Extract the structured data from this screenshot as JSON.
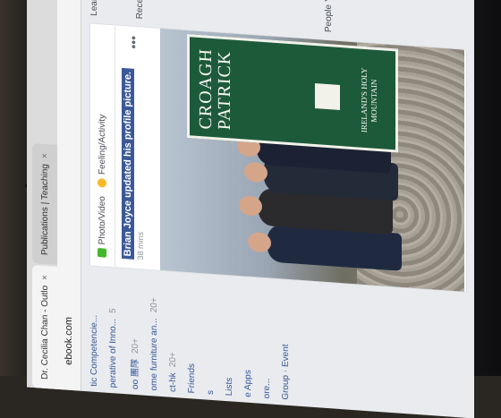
{
  "tabs": [
    {
      "label": "Dr. Cecilia Chan - Outlo"
    },
    {
      "label": "Publications | Teaching"
    }
  ],
  "address": "ebook.com",
  "left_nav": [
    {
      "label": "tic Competencie..."
    },
    {
      "label": "perative of Inno...",
      "count": "5"
    },
    {
      "label": "oo 團隊",
      "count": "20+"
    },
    {
      "label": "ome furniture an...",
      "count": "20+"
    },
    {
      "label": "ct-hk",
      "count": "20+"
    },
    {
      "label": "Friends"
    },
    {
      "label": "s"
    },
    {
      "label": "Lists"
    },
    {
      "label": "e Apps"
    },
    {
      "label": "ore..."
    },
    {
      "label": "Group"
    },
    {
      "label": "Event"
    }
  ],
  "composer": {
    "photo_video": "Photo/Video",
    "feeling": "Feeling/Activity"
  },
  "post": {
    "headline": "Brian Joyce updated his profile picture.",
    "time": "38 mins"
  },
  "sign": {
    "title_line1": "CROAGH PATRICK",
    "subtitle": "IRELAND'S HOLY MOUNTAIN"
  },
  "right_col": {
    "learn": "Lear",
    "recent": "Recent",
    "people": "People Yo"
  }
}
